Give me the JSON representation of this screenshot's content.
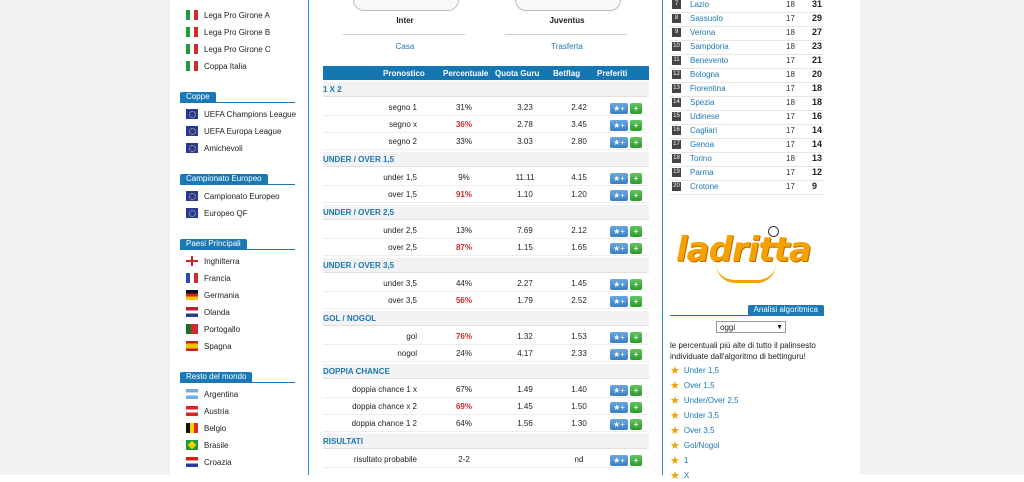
{
  "left_sidebar": {
    "top_items": [
      {
        "label": "Lega Pro Girone A",
        "flag": "it"
      },
      {
        "label": "Lega Pro Girone B",
        "flag": "it"
      },
      {
        "label": "Lega Pro Girone C",
        "flag": "it"
      },
      {
        "label": "Coppa Italia",
        "flag": "it"
      }
    ],
    "sections": [
      {
        "title": "Coppe",
        "items": [
          {
            "label": "UEFA Champions League",
            "flag": "eu"
          },
          {
            "label": "UEFA Europa League",
            "flag": "eu"
          },
          {
            "label": "Amichevoli",
            "flag": "eu"
          }
        ]
      },
      {
        "title": "Campionato Europeo",
        "items": [
          {
            "label": "Campionato Europeo",
            "flag": "eu"
          },
          {
            "label": "Europeo QF",
            "flag": "eu"
          }
        ]
      },
      {
        "title": "Paesi Principali",
        "items": [
          {
            "label": "Inghilterra",
            "flag": "en"
          },
          {
            "label": "Francia",
            "flag": "fr"
          },
          {
            "label": "Germania",
            "flag": "de"
          },
          {
            "label": "Olanda",
            "flag": "nl"
          },
          {
            "label": "Portogallo",
            "flag": "pt"
          },
          {
            "label": "Spagna",
            "flag": "es"
          }
        ]
      },
      {
        "title": "Resto del mondo",
        "items": [
          {
            "label": "Argentina",
            "flag": "ar"
          },
          {
            "label": "Austria",
            "flag": "at"
          },
          {
            "label": "Belgio",
            "flag": "be"
          },
          {
            "label": "Brasile",
            "flag": "br"
          },
          {
            "label": "Croazia",
            "flag": "hr"
          }
        ]
      }
    ]
  },
  "match": {
    "home_team": "Inter",
    "away_team": "Juventus",
    "home_label": "Casa",
    "away_label": "Trasferta"
  },
  "table": {
    "headers": {
      "pronostico": "Pronostico",
      "percentuale": "Percentuale",
      "quota": "Quota Guru",
      "betflag": "Betflag",
      "preferiti": "Preferiti"
    },
    "fav_button_label": "★+",
    "add_button_label": "+",
    "groups": [
      {
        "title": "1 X 2",
        "rows": [
          {
            "name": "segno 1",
            "pct": "31%",
            "quota": "3.23",
            "betflag": "2.42",
            "hi": false
          },
          {
            "name": "segno x",
            "pct": "36%",
            "quota": "2.78",
            "betflag": "3.45",
            "hi": true
          },
          {
            "name": "segno 2",
            "pct": "33%",
            "quota": "3.03",
            "betflag": "2.80",
            "hi": false
          }
        ]
      },
      {
        "title": "UNDER / OVER 1,5",
        "rows": [
          {
            "name": "under 1,5",
            "pct": "9%",
            "quota": "11.11",
            "betflag": "4.15",
            "hi": false
          },
          {
            "name": "over 1,5",
            "pct": "91%",
            "quota": "1.10",
            "betflag": "1.20",
            "hi": true
          }
        ]
      },
      {
        "title": "UNDER / OVER 2,5",
        "rows": [
          {
            "name": "under 2,5",
            "pct": "13%",
            "quota": "7.69",
            "betflag": "2.12",
            "hi": false
          },
          {
            "name": "over 2,5",
            "pct": "87%",
            "quota": "1.15",
            "betflag": "1.65",
            "hi": true
          }
        ]
      },
      {
        "title": "UNDER / OVER 3,5",
        "rows": [
          {
            "name": "under 3,5",
            "pct": "44%",
            "quota": "2.27",
            "betflag": "1.45",
            "hi": false
          },
          {
            "name": "over 3,5",
            "pct": "56%",
            "quota": "1.79",
            "betflag": "2.52",
            "hi": true
          }
        ]
      },
      {
        "title": "GOL / NOGOL",
        "rows": [
          {
            "name": "gol",
            "pct": "76%",
            "quota": "1.32",
            "betflag": "1.53",
            "hi": true
          },
          {
            "name": "nogol",
            "pct": "24%",
            "quota": "4.17",
            "betflag": "2.33",
            "hi": false
          }
        ]
      },
      {
        "title": "DOPPIA CHANCE",
        "rows": [
          {
            "name": "doppia chance 1 x",
            "pct": "67%",
            "quota": "1.49",
            "betflag": "1.40",
            "hi": false
          },
          {
            "name": "doppia chance x 2",
            "pct": "69%",
            "quota": "1.45",
            "betflag": "1.50",
            "hi": true
          },
          {
            "name": "doppia chance 1 2",
            "pct": "64%",
            "quota": "1.56",
            "betflag": "1.30",
            "hi": false
          }
        ]
      },
      {
        "title": "RISULTATI",
        "rows": [
          {
            "name": "risultato probabile",
            "pct": "2-2",
            "quota": "",
            "betflag": "nd",
            "hi": false
          }
        ]
      }
    ]
  },
  "standings": [
    {
      "pos": "7",
      "team": "Lazio",
      "g": "18",
      "p": "31"
    },
    {
      "pos": "8",
      "team": "Sassuolo",
      "g": "17",
      "p": "29"
    },
    {
      "pos": "9",
      "team": "Verona",
      "g": "18",
      "p": "27"
    },
    {
      "pos": "10",
      "team": "Sampdoria",
      "g": "18",
      "p": "23"
    },
    {
      "pos": "11",
      "team": "Benevento",
      "g": "17",
      "p": "21"
    },
    {
      "pos": "12",
      "team": "Bologna",
      "g": "18",
      "p": "20"
    },
    {
      "pos": "13",
      "team": "Fiorentina",
      "g": "17",
      "p": "18"
    },
    {
      "pos": "14",
      "team": "Spezia",
      "g": "18",
      "p": "18"
    },
    {
      "pos": "15",
      "team": "Udinese",
      "g": "17",
      "p": "16"
    },
    {
      "pos": "16",
      "team": "Cagliari",
      "g": "17",
      "p": "14"
    },
    {
      "pos": "17",
      "team": "Genoa",
      "g": "17",
      "p": "14"
    },
    {
      "pos": "18",
      "team": "Torino",
      "g": "18",
      "p": "13"
    },
    {
      "pos": "19",
      "team": "Parma",
      "g": "17",
      "p": "12"
    },
    {
      "pos": "20",
      "team": "Crotone",
      "g": "17",
      "p": "9"
    }
  ],
  "brand": {
    "logo_text": "ladritta"
  },
  "algoritmica": {
    "title": "Analisi algoritmica",
    "select_value": "oggi",
    "description": "le percentuali più alte di tutto il palinsesto individuate dall'algoritmo di bettinguru!",
    "items": [
      "Under 1,5",
      "Over 1,5",
      "Under/Over 2,5",
      "Under 3,5",
      "Over 3,5",
      "Gol/Nogol",
      "1",
      "X"
    ]
  },
  "colors": {
    "accent": "#1a78b4",
    "header": "#1577b2",
    "highlight": "#d32a2a",
    "logo": "#f5a200"
  }
}
